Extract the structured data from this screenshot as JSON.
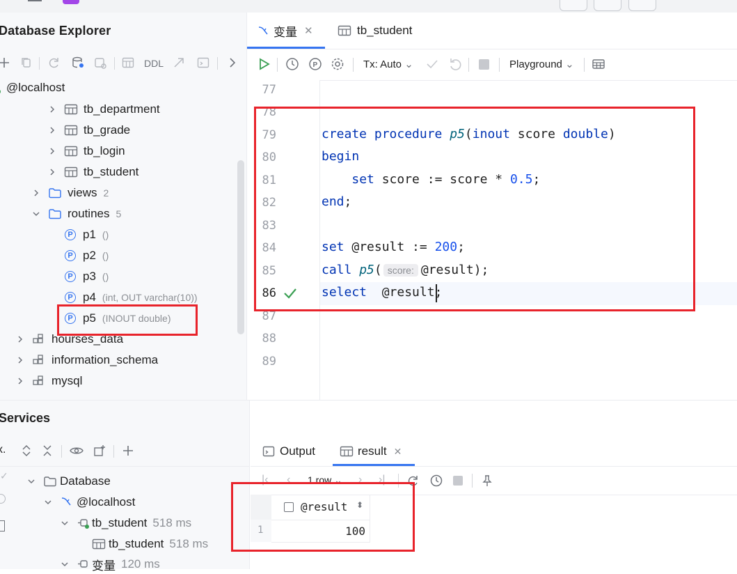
{
  "left_panel": {
    "title": "Database Explorer",
    "toolbar_ddl": "DDL",
    "host": "@localhost",
    "tables": [
      "tb_department",
      "tb_grade",
      "tb_login",
      "tb_student"
    ],
    "views": {
      "label": "views",
      "count": "2"
    },
    "routines": {
      "label": "routines",
      "count": "5"
    },
    "procedures": [
      {
        "name": "p1",
        "sig": "()"
      },
      {
        "name": "p2",
        "sig": "()"
      },
      {
        "name": "p3",
        "sig": "()"
      },
      {
        "name": "p4",
        "sig": "(int, OUT varchar(10))"
      },
      {
        "name": "p5",
        "sig": "(INOUT double)"
      }
    ],
    "schemas": [
      "hourses_data",
      "information_schema",
      "mysql"
    ]
  },
  "editor": {
    "tabs": [
      {
        "label": "变量",
        "active": true
      },
      {
        "label": "tb_student",
        "active": false
      }
    ],
    "tx_label": "Tx: Auto",
    "playground_label": "Playground",
    "line_numbers": [
      "77",
      "78",
      "79",
      "80",
      "81",
      "82",
      "83",
      "84",
      "85",
      "86",
      "87",
      "88",
      "89"
    ],
    "code": {
      "l79": {
        "kw1": "create procedure",
        "fn": "p5",
        "p": "(",
        "kw2": "inout",
        "t": " score ",
        "kw3": "double",
        "end": ")"
      },
      "l80": {
        "kw": "begin"
      },
      "l81": {
        "indent": "    ",
        "kw": "set",
        "t": " score := score * ",
        "num": "0.5",
        "end": ";"
      },
      "l82": {
        "kw": "end",
        "end": ";"
      },
      "l84": {
        "kw": "set",
        "t": " @result := ",
        "num": "200",
        "end": ";"
      },
      "l85": {
        "kw": "call",
        "t": " ",
        "fn": "p5",
        "p": "(",
        "hint": "score:",
        "end": "@result);"
      },
      "l86": {
        "kw": "select",
        "t": "  @result;"
      }
    }
  },
  "services": {
    "title": "Services",
    "tree": {
      "root": "Database",
      "host": "@localhost",
      "session1": {
        "label": "tb_student",
        "duration": "518 ms"
      },
      "result1": {
        "label": "tb_student",
        "duration": "518 ms"
      },
      "session2": {
        "label": "变量",
        "duration": "120 ms"
      }
    },
    "output_tabs": [
      "Output",
      "result"
    ],
    "pager_label": "1 row",
    "grid": {
      "column": "@result",
      "rows": [
        {
          "index": "1",
          "value": "100"
        }
      ]
    }
  },
  "colors": {
    "accent": "#3574f0",
    "highlight_box": "#e8232b",
    "keyword": "#0033b3",
    "number": "#1750eb",
    "check": "#3a9f53"
  }
}
